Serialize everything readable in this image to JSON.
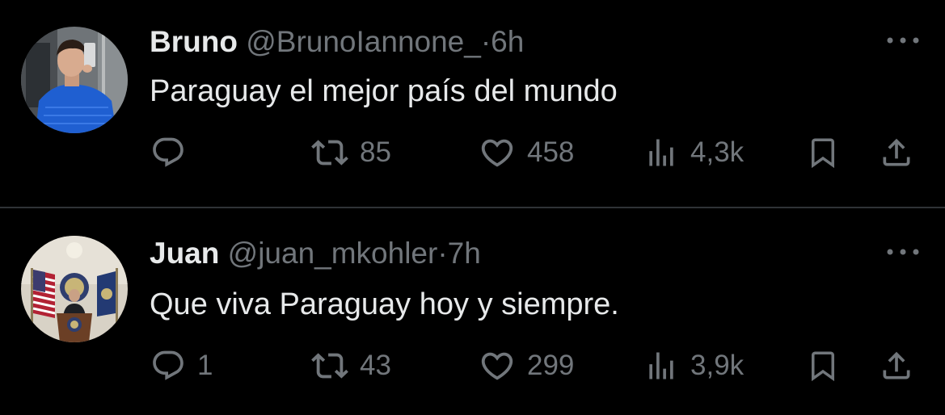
{
  "tweets": [
    {
      "name": "Bruno",
      "handle": "@BrunoIannone_",
      "separator": "·",
      "time": "6h",
      "text": "Paraguay el mejor país del mundo",
      "stats": {
        "replies": "",
        "retweets": "85",
        "likes": "458",
        "views": "4,3k"
      }
    },
    {
      "name": "Juan",
      "handle": "@juan_mkohler",
      "separator": "·",
      "time": "7h",
      "text": "Que viva Paraguay hoy y siempre.",
      "stats": {
        "replies": "1",
        "retweets": "43",
        "likes": "299",
        "views": "3,9k"
      }
    }
  ],
  "icons": {
    "reply": "reply-icon",
    "retweet": "retweet-icon",
    "like": "heart-icon",
    "views": "views-icon",
    "bookmark": "bookmark-icon",
    "share": "share-icon",
    "more": "more-icon"
  },
  "colors": {
    "background": "#000000",
    "text": "#e7e9ea",
    "muted": "#71767b",
    "divider": "#2f3336"
  }
}
